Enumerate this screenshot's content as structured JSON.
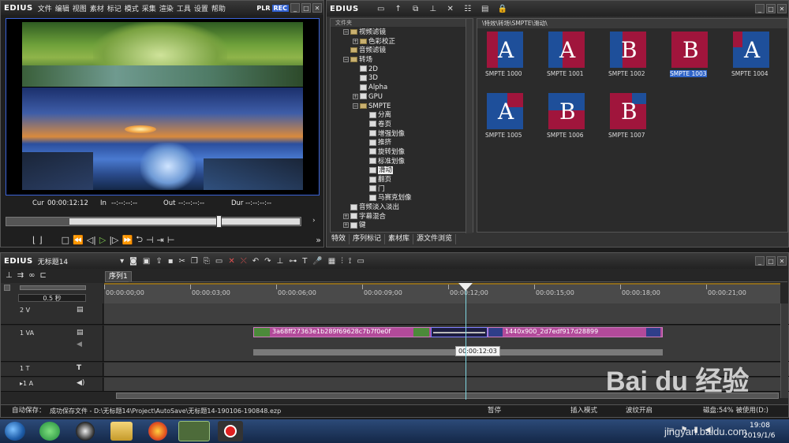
{
  "player": {
    "app": "EDIUS",
    "menu": [
      "文件",
      "编辑",
      "视图",
      "素材",
      "标记",
      "模式",
      "采集",
      "渲染",
      "工具",
      "设置",
      "帮助"
    ],
    "plr": "PLR",
    "rec": "REC",
    "cur_label": "Cur",
    "cur": "00:00:12:12",
    "in_label": "In",
    "in": "--:--:--:--",
    "out_label": "Out",
    "out": "--:--:--:--",
    "dur_label": "Dur",
    "dur": "--:--:--:--"
  },
  "library": {
    "app": "EDIUS",
    "folder_header": "文件夹",
    "path": "\\特效\\转场\\SMPTE\\滑动\\",
    "tree": [
      {
        "label": "视频滤镜",
        "indent": 1,
        "type": "folder",
        "toggle": "−"
      },
      {
        "label": "色彩校正",
        "indent": 2,
        "type": "folder",
        "toggle": "+"
      },
      {
        "label": "音频滤镜",
        "indent": 1,
        "type": "folder",
        "toggle": ""
      },
      {
        "label": "转场",
        "indent": 1,
        "type": "folder",
        "toggle": "−"
      },
      {
        "label": "2D",
        "indent": 2,
        "type": "fx",
        "toggle": ""
      },
      {
        "label": "3D",
        "indent": 2,
        "type": "fx",
        "toggle": ""
      },
      {
        "label": "Alpha",
        "indent": 2,
        "type": "fx",
        "toggle": ""
      },
      {
        "label": "GPU",
        "indent": 2,
        "type": "fx",
        "toggle": "+"
      },
      {
        "label": "SMPTE",
        "indent": 2,
        "type": "folder",
        "toggle": "−"
      },
      {
        "label": "分离",
        "indent": 3,
        "type": "fx",
        "toggle": ""
      },
      {
        "label": "卷页",
        "indent": 3,
        "type": "fx",
        "toggle": ""
      },
      {
        "label": "增强划像",
        "indent": 3,
        "type": "fx",
        "toggle": ""
      },
      {
        "label": "推挤",
        "indent": 3,
        "type": "fx",
        "toggle": ""
      },
      {
        "label": "旋转划像",
        "indent": 3,
        "type": "fx",
        "toggle": ""
      },
      {
        "label": "标准划像",
        "indent": 3,
        "type": "fx",
        "toggle": ""
      },
      {
        "label": "滑动",
        "indent": 3,
        "type": "fx",
        "toggle": "",
        "selected": true
      },
      {
        "label": "翻页",
        "indent": 3,
        "type": "fx",
        "toggle": ""
      },
      {
        "label": "门",
        "indent": 3,
        "type": "fx",
        "toggle": ""
      },
      {
        "label": "马赛克划像",
        "indent": 3,
        "type": "fx",
        "toggle": ""
      },
      {
        "label": "音频淡入淡出",
        "indent": 1,
        "type": "fx",
        "toggle": ""
      },
      {
        "label": "字幕混合",
        "indent": 1,
        "type": "fx",
        "toggle": "+"
      },
      {
        "label": "键",
        "indent": 1,
        "type": "fx",
        "toggle": "+"
      }
    ],
    "thumbs": [
      {
        "label": "SMPTE 1000",
        "letter": "A",
        "selected": false
      },
      {
        "label": "SMPTE 1001",
        "letter": "A",
        "selected": false
      },
      {
        "label": "SMPTE 1002",
        "letter": "B",
        "selected": false
      },
      {
        "label": "SMPTE 1003",
        "letter": "B",
        "selected": true
      },
      {
        "label": "SMPTE 1004",
        "letter": "A",
        "selected": false
      },
      {
        "label": "SMPTE 1005",
        "letter": "A",
        "selected": false
      },
      {
        "label": "SMPTE 1006",
        "letter": "B",
        "selected": false
      },
      {
        "label": "SMPTE 1007",
        "letter": "B",
        "selected": false
      }
    ],
    "tabs": [
      "特效",
      "序列标记",
      "素材库",
      "源文件浏览"
    ]
  },
  "timeline": {
    "app": "EDIUS",
    "project": "无标题14",
    "sequence_tab": "序列1",
    "zoom": "0.5 秒",
    "ruler": [
      "00:00:00;00",
      "00:00:03;00",
      "00:00:06;00",
      "00:00:09;00",
      "00:00:12;00",
      "00:00:15;00",
      "00:00:18;00",
      "00:00:21;00"
    ],
    "tracks": {
      "v2": "2 V",
      "va1": "1 VA",
      "t1": "1 T",
      "a1": "▸1 A"
    },
    "clip1": "3a68ff27363e1b289f69628c7b7f0e0f",
    "clip2": "1440x900_2d7edf917d28899",
    "tooltip": "00:00:12:03",
    "status": {
      "save_label": "自动保存：",
      "save_msg": "成功保存文件 - D:\\无标题14\\Project\\AutoSave\\无标题14-190106-190848.ezp",
      "pause": "暂停",
      "mode": "插入模式",
      "ripple": "波纹开启",
      "disk": "磁盘:54% 被使用(D:)"
    }
  },
  "taskbar": {
    "time": "19:08",
    "date": "2019/1/6"
  },
  "watermark": {
    "brand": "Bai du 经验",
    "url": "jingyan.baidu.com"
  }
}
